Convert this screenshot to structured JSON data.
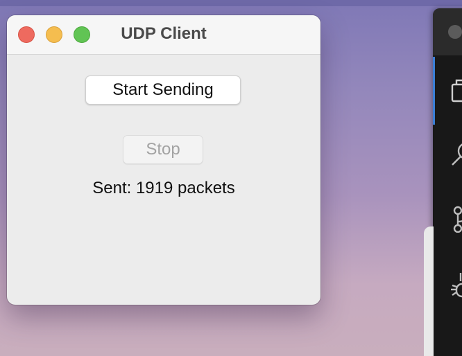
{
  "window": {
    "title": "UDP Client"
  },
  "controls": {
    "start_label": "Start Sending",
    "stop_label": "Stop",
    "stop_enabled": false
  },
  "status": {
    "sent_text": "Sent: 1919 packets",
    "sent_count": 1919
  },
  "background_window": {
    "activity_icons": [
      "files-icon",
      "search-icon",
      "source-control-icon",
      "debug-icon"
    ]
  },
  "colors": {
    "close": "#ee6a5f",
    "minimize": "#f5bd4f",
    "zoom": "#61c454",
    "accent": "#3b7fd6"
  }
}
